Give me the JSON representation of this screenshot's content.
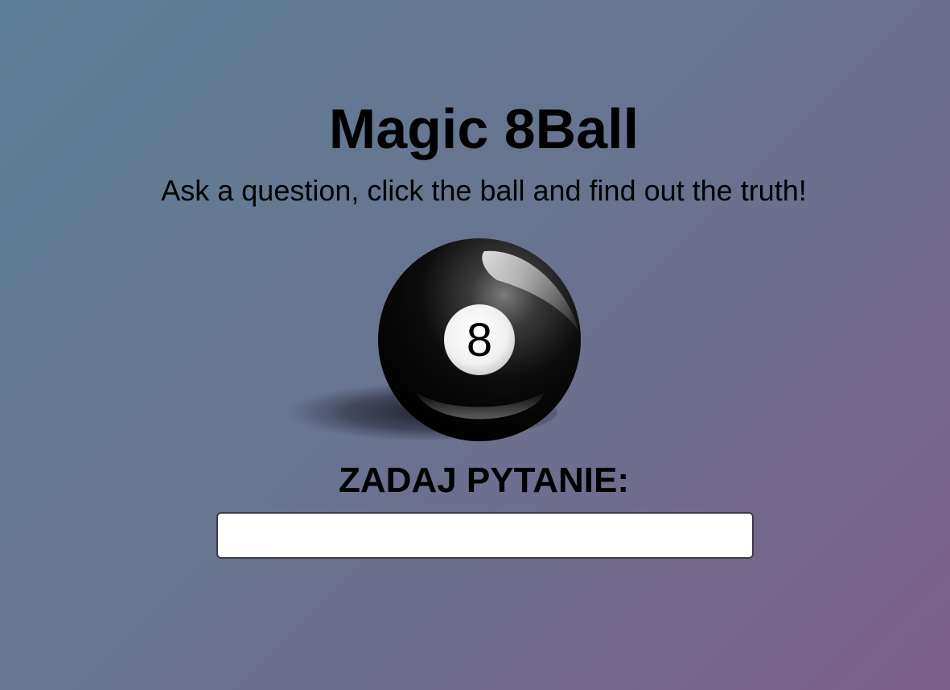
{
  "header": {
    "title": "Magic 8Ball",
    "subtitle": "Ask a question, click the ball and find out the truth!"
  },
  "ball": {
    "icon": "eight-ball-icon",
    "number": "8"
  },
  "question": {
    "label": "ZADAJ PYTANIE:",
    "value": "",
    "placeholder": ""
  },
  "colors": {
    "background_start": "#5e8096",
    "background_end": "#7c5f89",
    "ball": "#000000",
    "ball_circle": "#ffffff"
  }
}
